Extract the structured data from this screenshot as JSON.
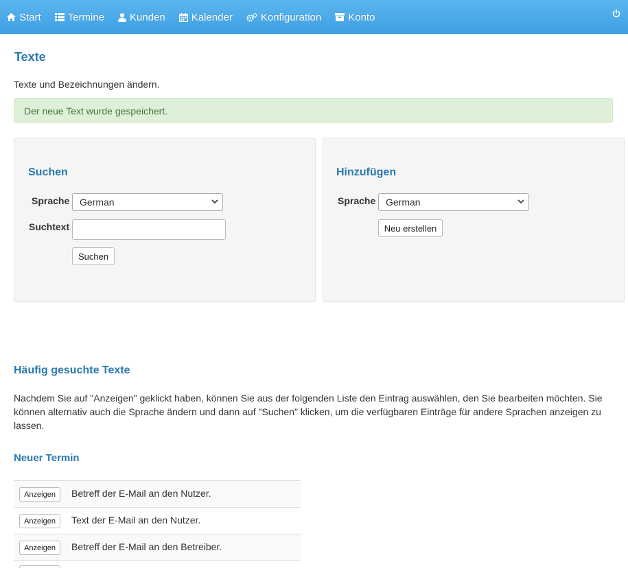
{
  "nav": {
    "items": [
      {
        "label": "Start",
        "icon": "home-icon"
      },
      {
        "label": "Termine",
        "icon": "list-icon"
      },
      {
        "label": "Kunden",
        "icon": "user-icon"
      },
      {
        "label": "Kalender",
        "icon": "calendar-icon"
      },
      {
        "label": "Konfiguration",
        "icon": "cogs-icon"
      },
      {
        "label": "Konto",
        "icon": "archive-icon"
      }
    ],
    "logout_icon": "power-icon"
  },
  "page": {
    "title": "Texte",
    "intro": "Texte und Bezeichnungen ändern.",
    "alert": "Der neue Text wurde gespeichert."
  },
  "search_panel": {
    "title": "Suchen",
    "language_label": "Sprache",
    "language_value": "German",
    "text_label": "Suchtext",
    "text_value": "",
    "button": "Suchen"
  },
  "add_panel": {
    "title": "Hinzufügen",
    "language_label": "Sprache",
    "language_value": "German",
    "button": "Neu erstellen"
  },
  "frequent": {
    "title": "Häufig gesuchte Texte",
    "description": "Nachdem Sie auf \"Anzeigen\" geklickt haben, können Sie aus der folgenden Liste den Eintrag auswählen, den Sie bearbeiten möchten. Sie können alternativ auch die Sprache ändern und dann auf \"Suchen\" klicken, um die verfügbaren Einträge für andere Sprachen anzeigen zu lassen.",
    "group_title": "Neuer Termin",
    "rows": [
      {
        "button": "Anzeigen",
        "text": "Betreff der E-Mail an den Nutzer."
      },
      {
        "button": "Anzeigen",
        "text": "Text der E-Mail an den Nutzer."
      },
      {
        "button": "Anzeigen",
        "text": "Betreff der E-Mail an den Betreiber."
      }
    ]
  },
  "colors": {
    "navbar": "#3d9fe2",
    "heading": "#2a7ab0",
    "alert_bg": "#dff0d8",
    "alert_text": "#3c763d"
  }
}
